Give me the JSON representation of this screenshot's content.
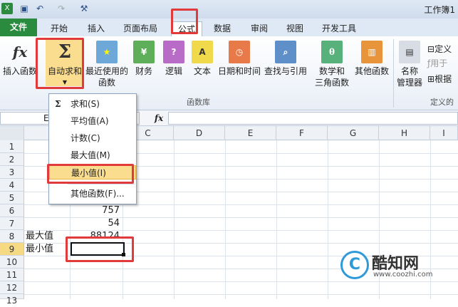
{
  "quick_access": {
    "save_icon": "save-icon",
    "undo_icon": "undo-icon",
    "redo_icon": "redo-icon",
    "customize_icon": "customize-icon"
  },
  "window_title": "工作簿1",
  "tabs": [
    "文件",
    "开始",
    "插入",
    "页面布局",
    "公式",
    "数据",
    "审阅",
    "视图",
    "开发工具"
  ],
  "ribbon": {
    "insert_function": "插入函数",
    "autosum": "自动求和",
    "recent_line1": "最近使用的",
    "recent_line2": "函数",
    "financial": "财务",
    "logical": "逻辑",
    "text": "文本",
    "datetime": "日期和时间",
    "lookup": "查找与引用",
    "math_line1": "数学和",
    "math_line2": "三角函数",
    "other": "其他函数",
    "name_mgr_line1": "名称",
    "name_mgr_line2": "管理器",
    "define": "定义",
    "use_in": "用于",
    "create_from": "根据",
    "group_library": "函数库",
    "group_defined": "定义的"
  },
  "formula_bar": {
    "fx": "fx",
    "namebox_partial": "E"
  },
  "columns": [
    "C",
    "D",
    "E",
    "F",
    "G",
    "H",
    "I"
  ],
  "rows": [
    "1",
    "2",
    "3",
    "4",
    "5",
    "6",
    "7",
    "8",
    "9",
    "10",
    "11",
    "12",
    "13"
  ],
  "cells": {
    "b6": "757",
    "b7": "54",
    "a8": "最大值",
    "b8": "88124",
    "a9": "最小值"
  },
  "menu": {
    "sum": "求和(S)",
    "average": "平均值(A)",
    "count": "计数(C)",
    "max": "最大值(M)",
    "min": "最小值(I)",
    "more": "其他函数(F)..."
  },
  "watermark": {
    "brand": "酷知网",
    "url": "www.coozhi.com"
  },
  "colors": {
    "accent_red": "#e03a3a",
    "file_tab": "#2a8a3e",
    "highlight": "#fbdd8f"
  }
}
